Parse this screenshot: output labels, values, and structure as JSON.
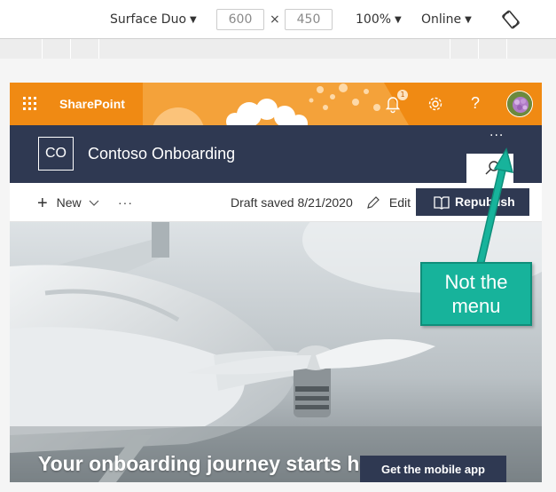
{
  "devtools": {
    "device_name": "Surface Duo",
    "width_value": "600",
    "height_value": "450",
    "dimension_separator": "×",
    "zoom": "100%",
    "throttling": "Online"
  },
  "suite_bar": {
    "brand": "SharePoint",
    "notification_count": "1",
    "help_label": "?",
    "bg_color": "#f08a13"
  },
  "site": {
    "logo_initials": "CO",
    "title": "Contoso Onboarding",
    "more_label": "···",
    "header_color": "#2f3952"
  },
  "command_bar": {
    "new_label": "New",
    "overflow_label": "···",
    "draft_status": "Draft saved 8/21/2020",
    "edit_label": "Edit",
    "republish_label": "Republish"
  },
  "hero": {
    "title": "Your onboarding journey starts he",
    "mobile_app_label": "Get the mobile app"
  },
  "annotation": {
    "callout_line1": "Not the",
    "callout_line2": "menu",
    "color": "#17b39b"
  }
}
